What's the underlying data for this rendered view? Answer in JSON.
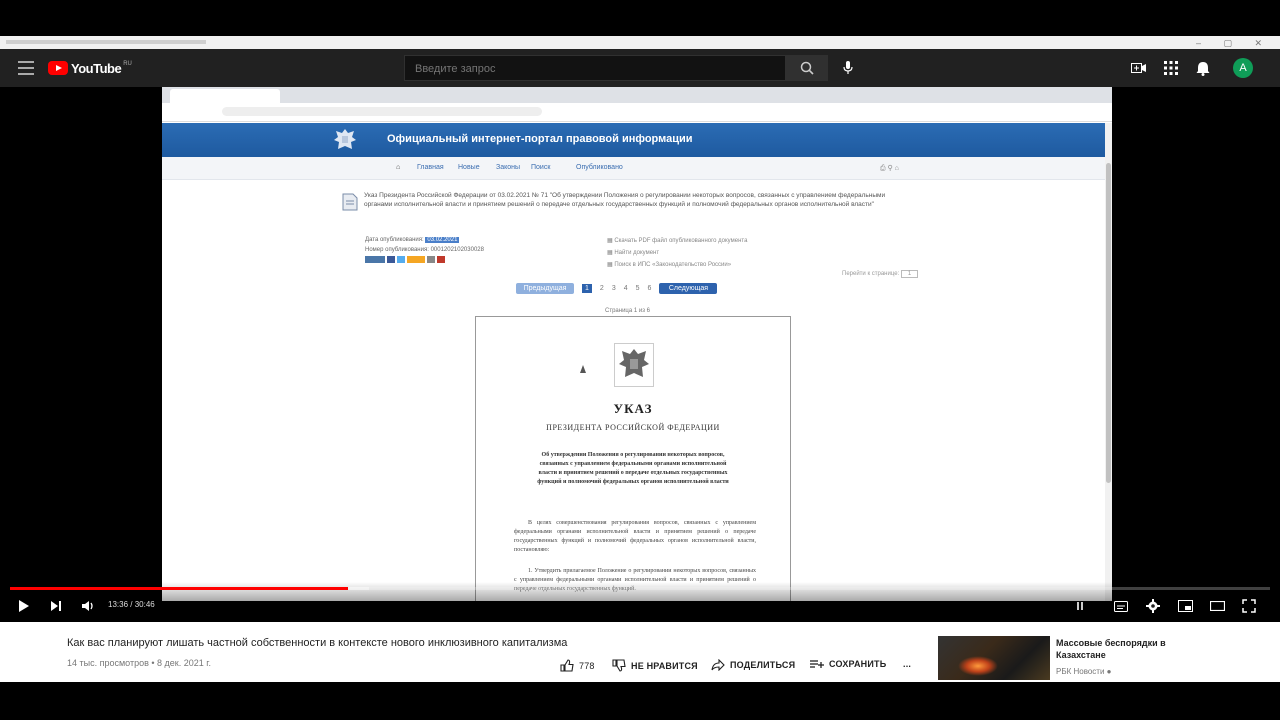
{
  "header": {
    "logo_text": "YouTube",
    "country": "RU",
    "search_placeholder": "Введите запрос",
    "avatar_letter": "A"
  },
  "embedded_page": {
    "portal_title": "Официальный интернет-портал правовой информации",
    "nav": [
      "Главная",
      "Новые",
      "Законы",
      "Поиск",
      "Опубликовано"
    ],
    "doc_title": "Указ Президента Российской Федерации от 03.02.2021 № 71 \"Об утверждении Положения о регулировании некоторых вопросов, связанных с управлением федеральными органами исполнительной власти и принятием решений о передаче отдельных государственных функций и полномочий федеральных органов исполнительной власти\"",
    "meta_left": {
      "date_label": "Дата опубликования:",
      "date_value": "03.02.2021",
      "number_label": "Номер опубликования:",
      "number_value": "0001202102030028"
    },
    "meta_right": [
      "Скачать PDF файл опубликованного документа",
      "Найти документ",
      "Поиск в ИПС «Законодательство России»"
    ],
    "pager": {
      "prev": "Предыдущая",
      "pages": [
        "1",
        "2",
        "3",
        "4",
        "5",
        "6"
      ],
      "current": "1",
      "next": "Следующая",
      "page_select_label": "Перейти к странице:",
      "page_select_value": "1",
      "page_label": "Страница 1 из 6"
    },
    "doc_page": {
      "heading": "УКАЗ",
      "subheading": "ПРЕЗИДЕНТА РОССИЙСКОЙ ФЕДЕРАЦИИ",
      "subject": "Об утверждении Положения о регулировании некоторых вопросов, связанных с управлением федеральными органами исполнительной власти и принятием решений о передаче отдельных государственных функций и полномочий федеральных органов исполнительной власти",
      "paragraph1": "В целях совершенствования регулирования вопросов, связанных с управлением федеральными органами исполнительной власти и принятием решений о передаче государственных функций и полномочий федеральных органов исполнительной власти, постановляю:",
      "paragraph2": "1. Утвердить прилагаемое Положение о регулировании некоторых вопросов, связанных с управлением федеральными органами исполнительной власти и принятием решений о передаче отдельных государственных функций."
    }
  },
  "player": {
    "time_current": "13:36",
    "time_total": "30:46",
    "progress_fraction": 0.268,
    "buffer_fraction": 0.285
  },
  "video": {
    "title": "Как вас планируют лишать частной собственности в контексте нового инклюзивного капитализма",
    "meta": "14 тыс. просмотров • 8 дек. 2021 г.",
    "likes": "778",
    "dislike_label": "НЕ НРАВИТСЯ",
    "share_label": "ПОДЕЛИТЬСЯ",
    "save_label": "СОХРАНИТЬ",
    "more_label": "..."
  },
  "recommendation": {
    "title": "Массовые беспорядки в Казахстане",
    "channel": "РБК Новости"
  }
}
